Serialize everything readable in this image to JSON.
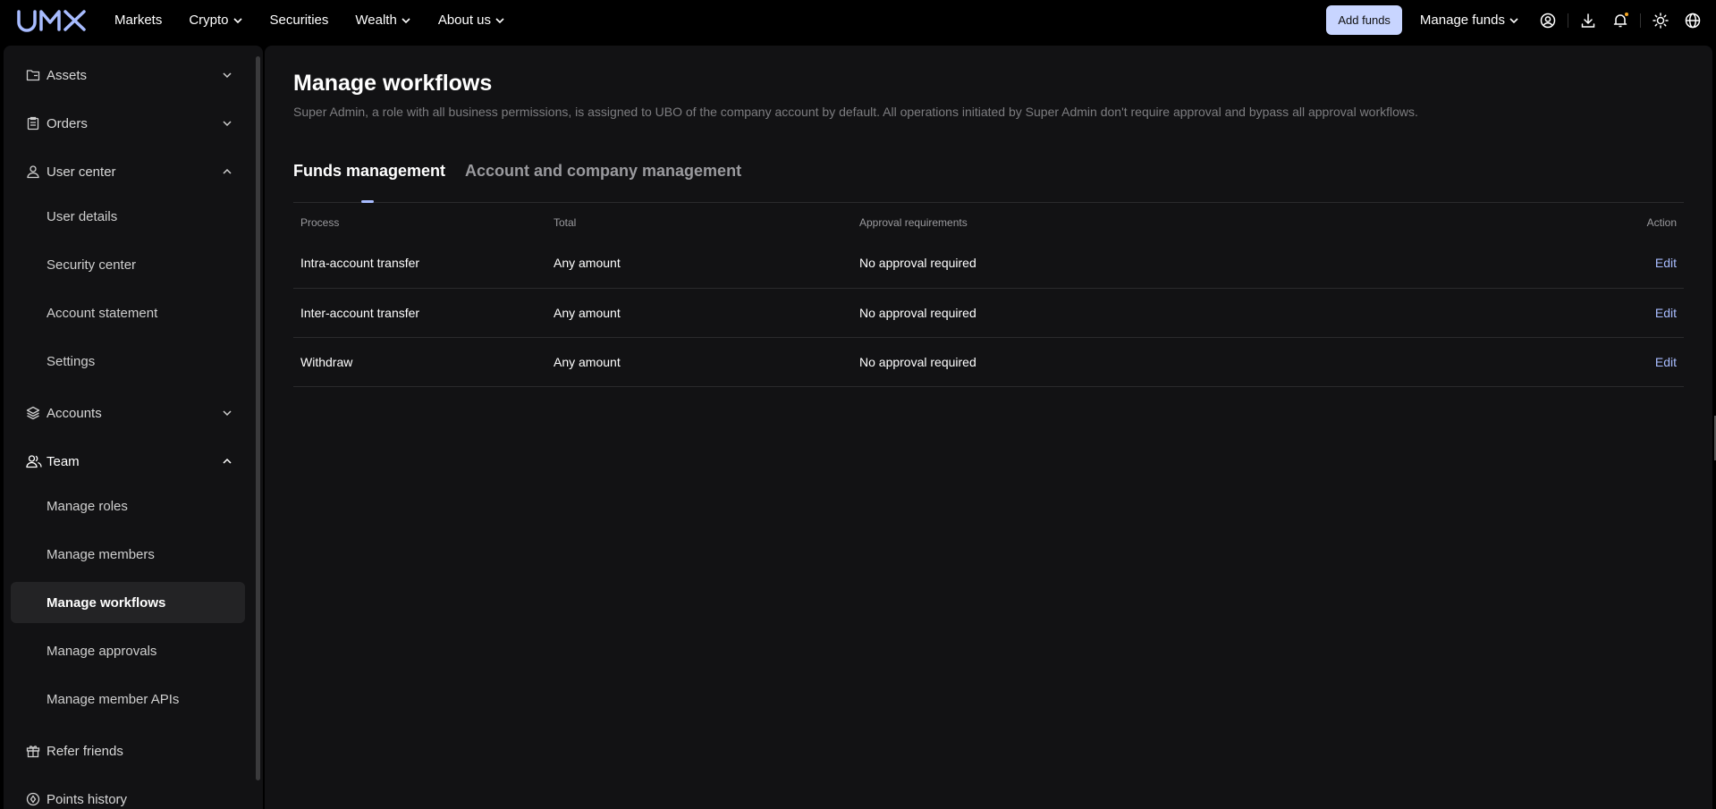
{
  "brand": {
    "name": "UMX"
  },
  "topnav": {
    "links": [
      {
        "label": "Markets",
        "has_dropdown": false
      },
      {
        "label": "Crypto",
        "has_dropdown": true
      },
      {
        "label": "Securities",
        "has_dropdown": false
      },
      {
        "label": "Wealth",
        "has_dropdown": true
      },
      {
        "label": "About us",
        "has_dropdown": true
      }
    ],
    "add_funds": "Add funds",
    "manage_funds": "Manage funds",
    "icons": [
      "user-circle-icon",
      "download-icon",
      "bell-icon",
      "sun-icon",
      "globe-icon"
    ]
  },
  "sidebar": {
    "items": [
      {
        "label": "Assets",
        "icon": "folder-icon",
        "chevron": "down"
      },
      {
        "label": "Orders",
        "icon": "clipboard-icon",
        "chevron": "down"
      },
      {
        "label": "User center",
        "icon": "user-icon",
        "chevron": "up"
      },
      {
        "label": "User details"
      },
      {
        "label": "Security center"
      },
      {
        "label": "Account statement"
      },
      {
        "label": "Settings"
      },
      {
        "label": "Accounts",
        "icon": "layers-icon",
        "chevron": "down"
      },
      {
        "label": "Team",
        "icon": "team-icon",
        "chevron": "up"
      },
      {
        "label": "Manage roles"
      },
      {
        "label": "Manage members"
      },
      {
        "label": "Manage workflows",
        "active": true
      },
      {
        "label": "Manage approvals"
      },
      {
        "label": "Manage member APIs"
      },
      {
        "label": "Refer friends",
        "icon": "gift-icon"
      },
      {
        "label": "Points history",
        "icon": "points-icon"
      }
    ]
  },
  "main": {
    "title": "Manage workflows",
    "subtitle": "Super Admin, a role with all business permissions, is assigned to UBO of the company account by default. All operations initiated by Super Admin don't require approval and bypass all approval workflows.",
    "tabs": [
      "Funds management",
      "Account and company management"
    ],
    "table": {
      "headers": [
        "Process",
        "Total",
        "Approval requirements",
        "Action"
      ],
      "rows": [
        [
          "Intra-account transfer",
          "Any amount",
          "No approval required",
          "Edit"
        ],
        [
          "Inter-account transfer",
          "Any amount",
          "No approval required",
          "Edit"
        ],
        [
          "Withdraw",
          "Any amount",
          "No approval required",
          "Edit"
        ]
      ]
    }
  },
  "colors": {
    "accent": "#a8bcff",
    "button_bg": "#c8d5ff",
    "panel_bg": "#121214",
    "notification_dot": "#f5a623"
  }
}
